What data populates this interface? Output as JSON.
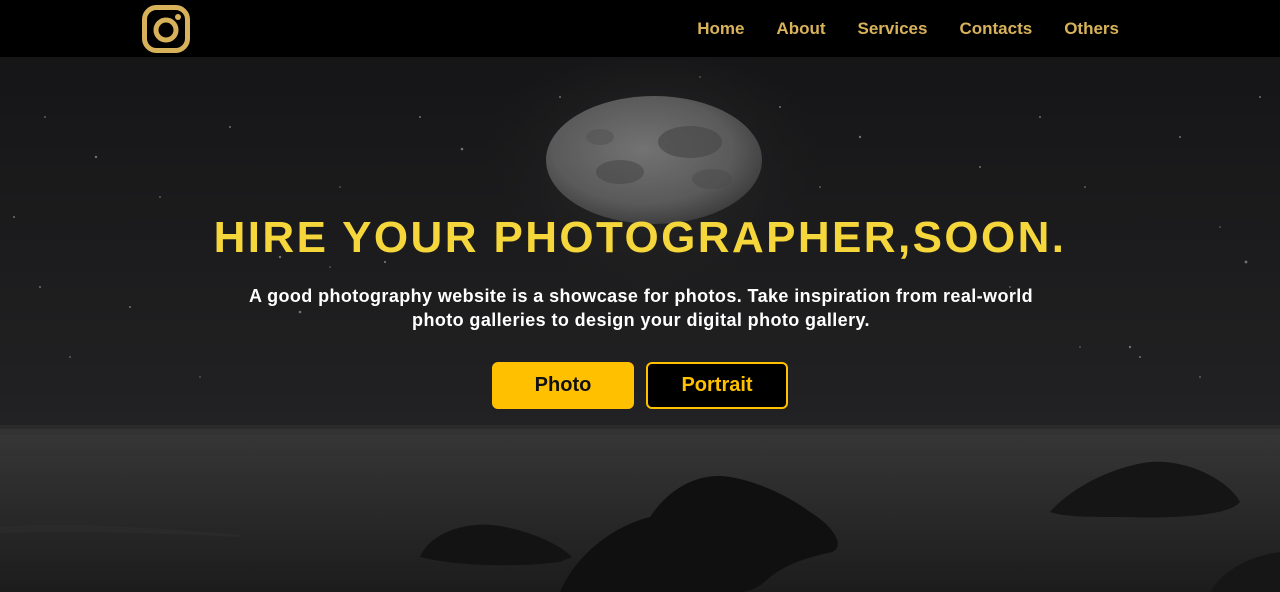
{
  "nav": {
    "logo_icon": "instagram-icon",
    "links": [
      {
        "label": "Home"
      },
      {
        "label": "About"
      },
      {
        "label": "Services"
      },
      {
        "label": "Contacts"
      },
      {
        "label": "Others"
      }
    ]
  },
  "hero": {
    "background_image": "night-sea-moon-rocks",
    "title": "HIRE YOUR PHOTOGRAPHER,SOON.",
    "subtitle": "A good photography website is a showcase for photos. Take inspiration from real-world photo galleries to design your digital photo gallery.",
    "buttons": {
      "photo_label": "Photo",
      "portrait_label": "Portrait"
    }
  },
  "colors": {
    "nav_link": "#d8b25a",
    "title": "#f5d63b",
    "accent": "#ffc000",
    "background": "#000000"
  }
}
